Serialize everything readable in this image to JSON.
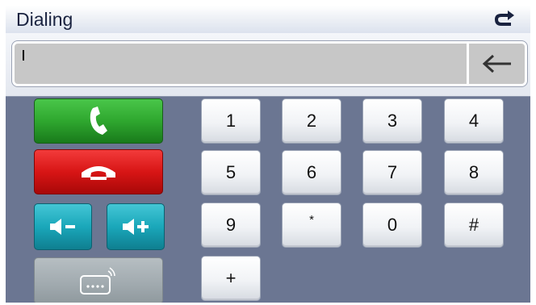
{
  "window": {
    "title": "Dialing"
  },
  "header": {
    "back_icon": "return-arrow-icon"
  },
  "display": {
    "number_value": "",
    "backspace_icon": "left-arrow-icon"
  },
  "keypad": {
    "keys": [
      "1",
      "2",
      "3",
      "4",
      "5",
      "6",
      "7",
      "8",
      "9",
      "*",
      "0",
      "#",
      "+"
    ]
  },
  "controls": {
    "call_icon": "phone-handset-icon",
    "hangup_icon": "hang-up-icon",
    "volume_down_icon": "volume-down-icon",
    "volume_up_icon": "volume-up-icon",
    "keypad_toggle_icon": "dialpad-icon"
  },
  "colors": {
    "call": "#2fa72f",
    "hangup": "#d81515",
    "volume": "#1aa7ba",
    "background": "#6b7692"
  }
}
